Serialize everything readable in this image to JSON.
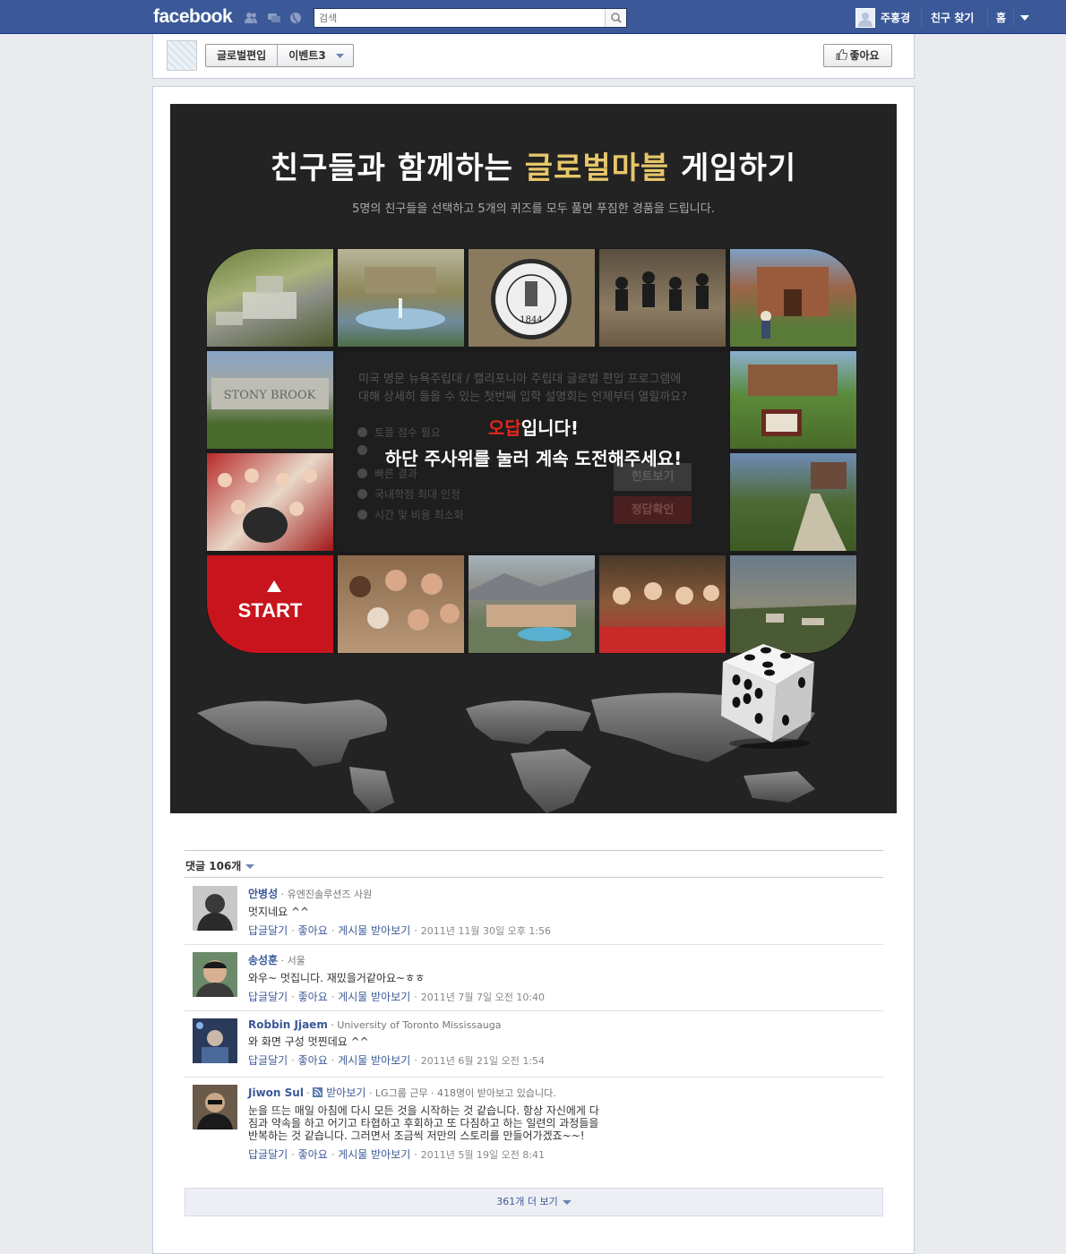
{
  "topbar": {
    "logo": "facebook",
    "search_placeholder": "검색",
    "user_name": "주홍경",
    "find_friends": "친구 찾기",
    "home": "홈"
  },
  "page": {
    "name_tab": "글로벌편입",
    "event_tab": "이벤트3",
    "like_button": "좋아요"
  },
  "game": {
    "title_part1": "친구들과 함께하는 ",
    "title_highlight": "글로벌마블",
    "title_part2": " 게임하기",
    "subtitle": "5명의 친구들을 선택하고 5개의 퀴즈를 모두 풀면 푸짐한 경품을 드립니다.",
    "question_line1": "미국 명문 뉴욕주립대 / 캘리포니아 주립대 글로벌 편입 프로그램에",
    "question_line2": "대해 상세히 들을 수 있는 첫번째 입학 설명회는 언제부터 열릴까요?",
    "options": [
      "토플 점수 필요",
      "",
      "빠른 결과",
      "국내학점 최대 인정",
      "시간 및 비용 최소화"
    ],
    "hint_button": "힌트보기",
    "answer_button": "정답확인",
    "wrong_red": "오답",
    "wrong_rest": "입니다!",
    "retry_message": "하단 주사위를 눌러 계속 도전해주세요!",
    "start_label": "START",
    "seal_text": "1844"
  },
  "comments": {
    "count_label": "댓글 106개",
    "items": [
      {
        "name": "안병성",
        "meta": " · 유엔진솔루션즈 사원",
        "text": "멋지네요 ^^",
        "reply": "답글달기",
        "like": "좋아요",
        "follow": "게시물 받아보기",
        "time": "2011년 11월 30일 오후 1:56"
      },
      {
        "name": "송성훈",
        "meta": " · 서울",
        "text": "와우~ 멋집니다. 재밌을거같아요~ㅎㅎ",
        "reply": "답글달기",
        "like": "좋아요",
        "follow": "게시물 받아보기",
        "time": "2011년 7월 7일 오전 10:40"
      },
      {
        "name": "Robbin Jjaem",
        "meta": " · University of Toronto Mississauga",
        "text": "와 화면 구성 멋찐데요 ^^",
        "reply": "답글달기",
        "like": "좋아요",
        "follow": "게시물 받아보기",
        "time": "2011년 6월 21일 오전 1:54"
      },
      {
        "name": "Jiwon Sul",
        "subscribe": "받아보기",
        "meta": " · LG그룹 근무 · 418명이 받아보고 있습니다.",
        "text_line1": "눈을 뜨는 매일 아침에 다시 모든 것을 시작하는 것 같습니다. 항상 자신에게 다",
        "text_line2": "짐과 약속을 하고 어기고 타협하고 후회하고 또 다짐하고 하는 일련의 과정들을",
        "text_line3": "반복하는 것 같습니다. 그러면서 조금씩 저만의 스토리를 만들어가겠죠~~!",
        "reply": "답글달기",
        "like": "좋아요",
        "follow": "게시물 받아보기",
        "time": "2011년 5월 19일 오전 8:41"
      }
    ],
    "more_label": "361개 더 보기"
  },
  "colors": {
    "facebook_blue": "#3b5998",
    "start_red": "#c8141c",
    "title_gold": "#e6c66a"
  }
}
